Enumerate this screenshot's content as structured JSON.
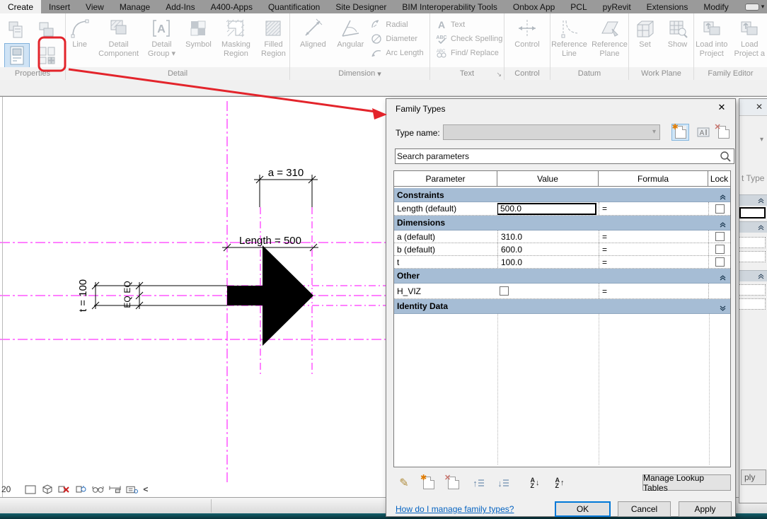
{
  "tabs": [
    {
      "label": "Create",
      "active": true
    },
    {
      "label": "Insert"
    },
    {
      "label": "View"
    },
    {
      "label": "Manage"
    },
    {
      "label": "Add-Ins"
    },
    {
      "label": "A400-Apps"
    },
    {
      "label": "Quantification"
    },
    {
      "label": "Site Designer"
    },
    {
      "label": "BIM Interoperability Tools"
    },
    {
      "label": "Onbox App"
    },
    {
      "label": "PCL"
    },
    {
      "label": "pyRevit"
    },
    {
      "label": "Extensions"
    },
    {
      "label": "Modify"
    }
  ],
  "ribbon": {
    "properties_label": "Properties",
    "detail": {
      "label": "Detail",
      "line": "Line",
      "detail_component": "Detail Component",
      "detail_group": "Detail Group",
      "symbol": "Symbol",
      "masking_region": "Masking Region",
      "filled_region": "Filled Region"
    },
    "dimension": {
      "label": "Dimension",
      "aligned": "Aligned",
      "angular": "Angular",
      "radial": "Radial",
      "diameter": "Diameter",
      "arc_length": "Arc Length"
    },
    "text": {
      "label": "Text",
      "text": "Text",
      "check_spelling": "Check Spelling",
      "find_replace": "Find/ Replace"
    },
    "control": {
      "label": "Control",
      "control": "Control"
    },
    "datum": {
      "label": "Datum",
      "reference_line": "Reference Line",
      "reference_plane": "Reference Plane"
    },
    "work_plane": {
      "label": "Work Plane",
      "set": "Set",
      "show": "Show"
    },
    "family_editor": {
      "label": "Family Editor",
      "load_into_project": "Load into Project",
      "load_project": "Load Project a"
    }
  },
  "canvas": {
    "dim_a": "a = 310",
    "dim_length": "Length = 500",
    "dim_t": "t = 100",
    "eq_top": "EQ",
    "eq_bottom": "EQ",
    "scale": "20"
  },
  "dialog": {
    "title": "Family Types",
    "type_name_label": "Type name:",
    "search_placeholder": "Search parameters",
    "columns": {
      "parameter": "Parameter",
      "value": "Value",
      "formula": "Formula",
      "lock": "Lock"
    },
    "rows": [
      {
        "kind": "group",
        "label": "Constraints"
      },
      {
        "kind": "param",
        "name": "Length (default)",
        "value": "500.0",
        "formula": "=",
        "lock": "unchecked",
        "selected": true
      },
      {
        "kind": "group",
        "label": "Dimensions"
      },
      {
        "kind": "param",
        "name": "a (default)",
        "value": "310.0",
        "formula": "=",
        "lock": "unchecked"
      },
      {
        "kind": "param",
        "name": "b (default)",
        "value": "600.0",
        "formula": "=",
        "lock": "unchecked"
      },
      {
        "kind": "param",
        "name": "t",
        "value": "100.0",
        "formula": "=",
        "lock": "unchecked"
      },
      {
        "kind": "group",
        "label": "Other"
      },
      {
        "kind": "param",
        "name": "H_VIZ",
        "value": "",
        "formula": "=",
        "value_checkbox": "unchecked"
      },
      {
        "kind": "group",
        "label": "Identity Data",
        "collapsed": true
      }
    ],
    "manage_lookup_tables": "Manage Lookup Tables",
    "help_link": "How do I manage family types?",
    "ok": "OK",
    "cancel": "Cancel",
    "apply": "Apply"
  },
  "side_panel": {
    "edit_type_fragment": "t Type",
    "apply_fragment": "ply"
  },
  "glyphs": {
    "dropdown": "▾",
    "dialog_launcher": "↘",
    "close": "✕",
    "chevron_left": "<",
    "letter_a": "A",
    "letter_z": "Z",
    "arrow_up": "↑",
    "arrow_down": "↓",
    "abc": "ABC",
    "pencil": "✎",
    "star": "✱",
    "x_mark": "✕",
    "panel_collapse": "▾"
  },
  "colors": {
    "annotation_red": "#e3242b",
    "reference_magenta": "#ff00ff",
    "group_header_blue": "#a6bdd5",
    "focus_blue": "#0078d7"
  }
}
